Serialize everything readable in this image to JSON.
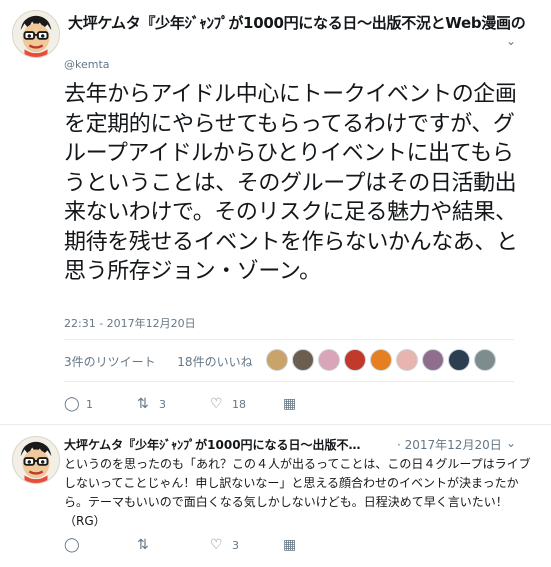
{
  "main": {
    "name": "大坪ケムタ『少年ｼﾞｬﾝﾌﾟが1000円になる日〜出版不況とWeb漫画の",
    "handle": "@kemta",
    "text": "去年からアイドル中心にトークイベントの企画を定期的にやらせてもらってるわけですが、グループアイドルからひとりイベントに出てもらうということは、そのグループはその日活動出来ないわけで。そのリスクに足る魅力や結果、期待を残せるイベントを作らないかんなあ、と思う所存ジョン・ゾーン。",
    "timestamp": "22:31 - 2017年12月20日",
    "retweets_label": "3件のリツイート",
    "likes_label": "18件のいいね",
    "actions": {
      "reply_count": "1",
      "retweet_count": "3",
      "like_count": "18",
      "stats_count": ""
    },
    "likers": [
      "#c9a36a",
      "#6b5e4e",
      "#d8a6b8",
      "#c0392b",
      "#e67e22",
      "#e8b4b0",
      "#8e6e8c",
      "#2c3e50",
      "#7f8c8d"
    ]
  },
  "reply": {
    "name": "大坪ケムタ『少年ｼﾞｬﾝﾌﾟが1000円になる日〜出版不…",
    "time": "· 2017年12月20日",
    "text": "というのを思ったのも「あれ？この４人が出るってことは、この日４グループはライブしないってことじゃん！申し訳ないなー」と思える顔合わせのイベントが決まったから。テーマもいいので面白くなる気しかしないけども。日程決めて早く言いたい！（RG）",
    "actions": {
      "reply_count": "",
      "retweet_count": "",
      "like_count": "3",
      "stats_count": ""
    }
  },
  "icons": {
    "reply": "reply-icon",
    "retweet": "retweet-icon",
    "like": "heart-icon",
    "stats": "analytics-icon",
    "chevron": "chevron-down-icon"
  }
}
